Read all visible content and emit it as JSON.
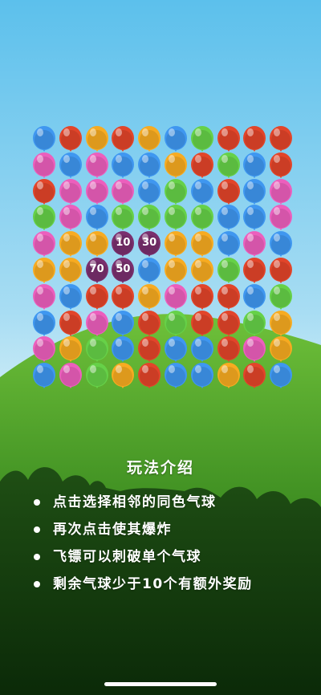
{
  "palette": {
    "b": "#3f97f0",
    "r": "#e2452a",
    "y": "#f7ab21",
    "p": "#ec5fbd",
    "g": "#66d148",
    "m": "#7a2f6e"
  },
  "board": {
    "rows": [
      [
        "b",
        "r",
        "y",
        "r",
        "y",
        "b",
        "g",
        "r",
        "r",
        "r"
      ],
      [
        "p",
        "b",
        "p",
        "b",
        "b",
        "y",
        "r",
        "g",
        "b",
        "r"
      ],
      [
        "r",
        "p",
        "p",
        "p",
        "b",
        "g",
        "b",
        "r",
        "b",
        "p"
      ],
      [
        "g",
        "p",
        "b",
        "g",
        "g",
        "g",
        "g",
        "b",
        "b",
        "p"
      ],
      [
        "p",
        "y",
        "y",
        "m",
        "m",
        "y",
        "y",
        "b",
        "p",
        "b"
      ],
      [
        "y",
        "y",
        "m",
        "m",
        "b",
        "y",
        "y",
        "g",
        "r",
        "r"
      ],
      [
        "p",
        "b",
        "r",
        "r",
        "y",
        "p",
        "r",
        "r",
        "b",
        "g"
      ],
      [
        "b",
        "r",
        "p",
        "b",
        "r",
        "g",
        "r",
        "r",
        "g",
        "y"
      ],
      [
        "p",
        "y",
        "g",
        "b",
        "r",
        "b",
        "b",
        "r",
        "p",
        "y"
      ],
      [
        "b",
        "p",
        "g",
        "y",
        "r",
        "b",
        "b",
        "y",
        "r",
        "b"
      ]
    ],
    "score_balloons": [
      {
        "row": 4,
        "col": 3,
        "label": "10"
      },
      {
        "row": 4,
        "col": 4,
        "label": "30"
      },
      {
        "row": 5,
        "col": 2,
        "label": "70"
      },
      {
        "row": 5,
        "col": 3,
        "label": "50"
      }
    ]
  },
  "rules": {
    "title": "玩法介绍",
    "items": [
      "点击选择相邻的同色气球",
      "再次点击使其爆炸",
      "飞镖可以刺破单个气球",
      "剩余气球少于10个有额外奖励"
    ]
  }
}
